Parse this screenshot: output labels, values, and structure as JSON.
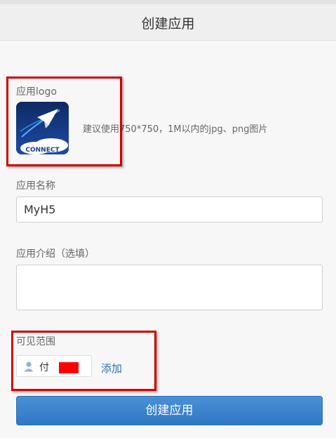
{
  "header": {
    "title": "创建应用"
  },
  "logo_section": {
    "label": "应用logo",
    "logo_text": "CONNECT",
    "hint": "建议使用750*750，1M以内的jpg、png图片"
  },
  "name_section": {
    "label": "应用名称",
    "value": "MyH5"
  },
  "intro_section": {
    "label": "应用介绍（选填）",
    "value": ""
  },
  "visibility_section": {
    "label": "可见范围",
    "user_name": "付",
    "add_label": "添加"
  },
  "submit": {
    "label": "创建应用"
  },
  "colors": {
    "accent": "#2f78c4",
    "highlight": "#d40000",
    "redaction": "#ff0000"
  }
}
